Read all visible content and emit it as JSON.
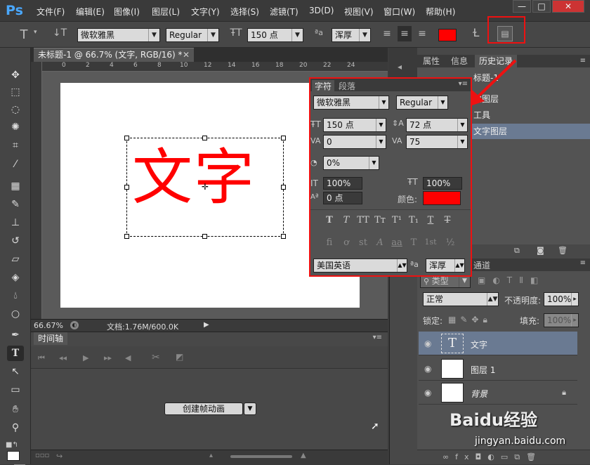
{
  "app": {
    "logo": "Ps"
  },
  "menu": [
    "文件(F)",
    "编辑(E)",
    "图像(I)",
    "图层(L)",
    "文字(Y)",
    "选择(S)",
    "滤镜(T)",
    "3D(D)",
    "视图(V)",
    "窗口(W)",
    "帮助(H)"
  ],
  "window_controls": [
    "—",
    "□",
    "✕"
  ],
  "options": {
    "font_family": "微软雅黑",
    "font_style": "Regular",
    "font_size": "150 点",
    "antialias": "浑厚",
    "text_color": "#ff0000"
  },
  "document": {
    "tab_title": "未标题-1 @ 66.7% (文字, RGB/16) *",
    "text": "文字",
    "text_color": "#ff0000",
    "zoom": "66.67%",
    "doc_size": "文档:1.76M/600.0K",
    "ruler_labels": [
      "0",
      "2",
      "4",
      "6",
      "8",
      "10",
      "12",
      "14",
      "16",
      "18",
      "20",
      "22",
      "24"
    ]
  },
  "timeline": {
    "tab": "时间轴",
    "create_button": "创建帧动画"
  },
  "history": {
    "tabs": [
      "属性",
      "信息",
      "历史记录"
    ],
    "items": [
      "标题-1",
      "建图层",
      "工具",
      "文字图层"
    ]
  },
  "character": {
    "tabs": [
      "字符",
      "段落"
    ],
    "font_family": "微软雅黑",
    "font_style": "Regular",
    "size": "150 点",
    "leading": "72 点",
    "kerning": "0",
    "tracking": "75",
    "scale_percent": "0%",
    "vertical_scale": "100%",
    "horizontal_scale": "100%",
    "baseline": "0 点",
    "color_label": "颜色:",
    "color": "#ff0000",
    "language": "美国英语",
    "antialias": "浑厚",
    "format_buttons": [
      "T",
      "T",
      "TT",
      "Tт",
      "T¹",
      "T₁",
      "T",
      "T"
    ],
    "opentype_buttons": [
      "fi",
      "ơ",
      "st",
      "A",
      "aa",
      "T",
      "1st",
      "½"
    ]
  },
  "layers": {
    "tab": "通道",
    "filter": "类型",
    "blend_mode": "正常",
    "opacity_label": "不透明度:",
    "opacity": "100%",
    "lock_label": "锁定:",
    "fill_label": "填充:",
    "fill": "100%",
    "items": [
      "文字",
      "图层 1",
      "背景"
    ]
  },
  "watermark": {
    "brand": "Baidu经验",
    "url": "jingyan.baidu.com"
  }
}
